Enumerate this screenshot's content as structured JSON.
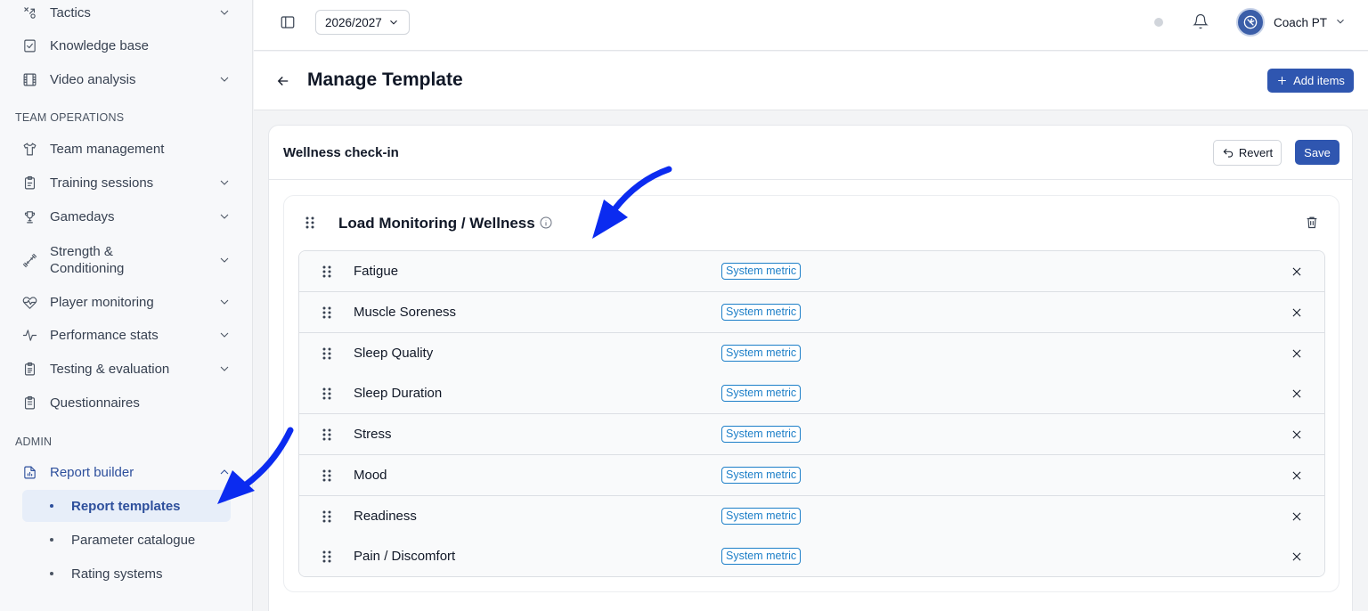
{
  "sidebar": {
    "items_top": [
      {
        "label": "Tactics",
        "icon": "tactics-icon",
        "has_chevron": true
      },
      {
        "label": "Knowledge base",
        "icon": "checklist-icon",
        "has_chevron": false
      },
      {
        "label": "Video analysis",
        "icon": "film-icon",
        "has_chevron": true
      }
    ],
    "section_team": "TEAM OPERATIONS",
    "items_team": [
      {
        "label": "Team management",
        "icon": "shirt-icon",
        "has_chevron": false
      },
      {
        "label": "Training sessions",
        "icon": "clipboard-icon",
        "has_chevron": true
      },
      {
        "label": "Gamedays",
        "icon": "trophy-icon",
        "has_chevron": true
      },
      {
        "label": "Strength &",
        "label2": "Conditioning",
        "icon": "dumbbell-icon",
        "has_chevron": true
      },
      {
        "label": "Player monitoring",
        "icon": "heart-pulse-icon",
        "has_chevron": true
      },
      {
        "label": "Performance stats",
        "icon": "activity-icon",
        "has_chevron": true
      },
      {
        "label": "Testing & evaluation",
        "icon": "clipboard-list-icon",
        "has_chevron": true
      },
      {
        "label": "Questionnaires",
        "icon": "clipboard-check-icon",
        "has_chevron": false
      }
    ],
    "section_admin": "ADMIN",
    "report_builder": {
      "label": "Report builder",
      "icon": "report-icon"
    },
    "sub_items": [
      {
        "label": "Report templates",
        "active": true
      },
      {
        "label": "Parameter catalogue",
        "active": false
      },
      {
        "label": "Rating systems",
        "active": false
      }
    ]
  },
  "topbar": {
    "season": "2026/2027",
    "user_name": "Coach PT"
  },
  "header": {
    "title": "Manage Template",
    "add_items_label": "Add items"
  },
  "card": {
    "title": "Wellness check-in",
    "revert_label": "Revert",
    "save_label": "Save",
    "section_title": "Load Monitoring / Wellness",
    "rows": [
      {
        "label": "Fatigue",
        "badge": "System metric"
      },
      {
        "label": "Muscle Soreness",
        "badge": "System metric"
      },
      {
        "label": "Sleep Quality",
        "badge": "System metric"
      },
      {
        "label": "Sleep Duration",
        "badge": "System metric"
      },
      {
        "label": "Stress",
        "badge": "System metric"
      },
      {
        "label": "Mood",
        "badge": "System metric"
      },
      {
        "label": "Readiness",
        "badge": "System metric"
      },
      {
        "label": "Pain / Discomfort",
        "badge": "System metric"
      }
    ]
  },
  "colors": {
    "primary": "#2f56b0",
    "active_nav": "#2d4f9c",
    "badge": "#1d7fc8",
    "arrow": "#0b2bf0"
  }
}
